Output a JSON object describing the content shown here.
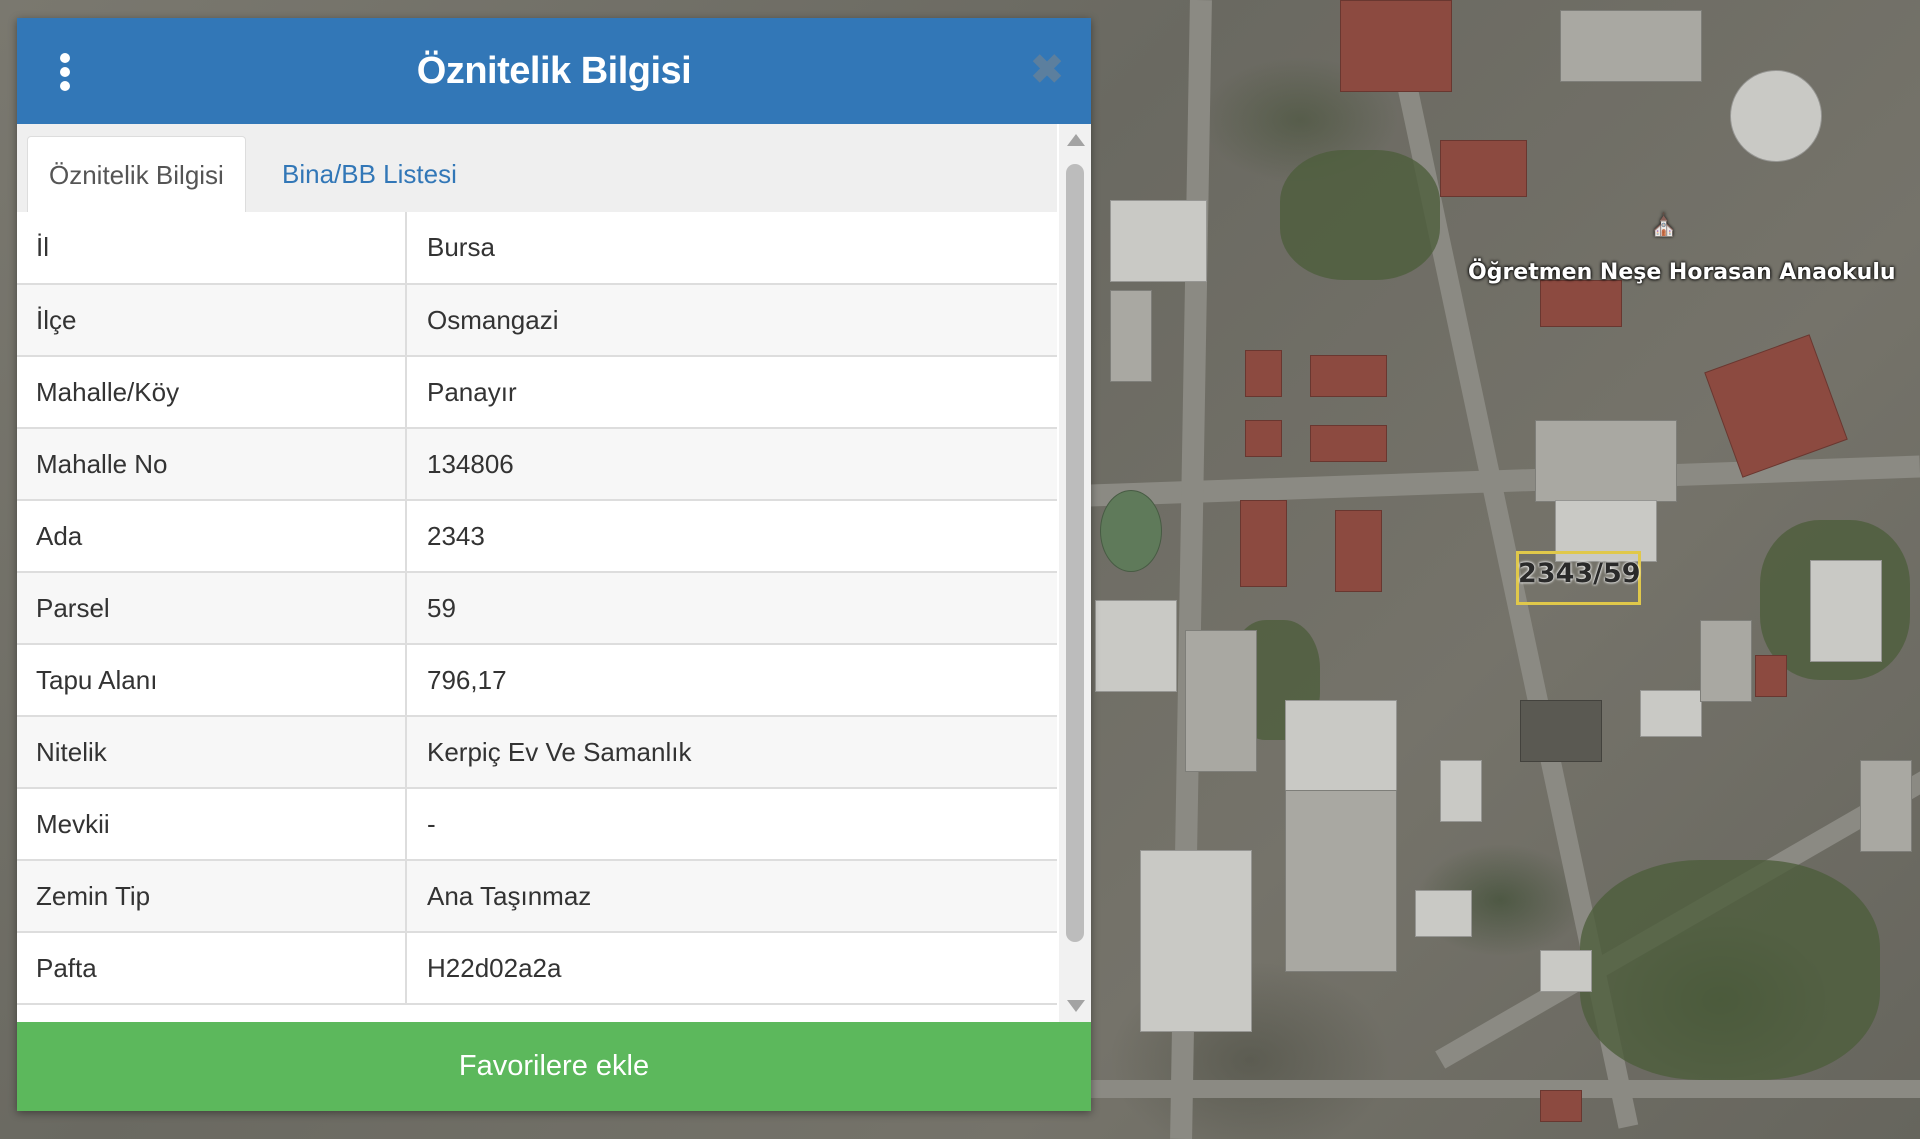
{
  "panel": {
    "title": "Öznitelik Bilgisi",
    "menu_icon": "vertical-ellipsis-icon",
    "close_icon": "close-icon",
    "close_glyph": "✖",
    "header_color": "#3277b7"
  },
  "tabs": [
    {
      "label": "Öznitelik Bilgisi",
      "active": true
    },
    {
      "label": "Bina/BB Listesi",
      "active": false
    }
  ],
  "attributes": [
    {
      "key": "İl",
      "value": "Bursa"
    },
    {
      "key": "İlçe",
      "value": "Osmangazi"
    },
    {
      "key": "Mahalle/Köy",
      "value": "Panayır"
    },
    {
      "key": "Mahalle No",
      "value": "134806"
    },
    {
      "key": "Ada",
      "value": "2343"
    },
    {
      "key": "Parsel",
      "value": "59"
    },
    {
      "key": "Tapu Alanı",
      "value": "796,17"
    },
    {
      "key": "Nitelik",
      "value": "Kerpiç Ev Ve Samanlık"
    },
    {
      "key": "Mevkii",
      "value": "-"
    },
    {
      "key": "Zemin Tip",
      "value": "Ana Taşınmaz"
    },
    {
      "key": "Pafta",
      "value": "H22d02a2a"
    }
  ],
  "footer": {
    "favorite_label": "Favorilere ekle",
    "button_color": "#5cb85c"
  },
  "map": {
    "school_label": "Öğretmen Neşe Horasan Anaokulu",
    "parcel_label": "2343/59",
    "parcel_highlight_color": "#e0c84a"
  }
}
